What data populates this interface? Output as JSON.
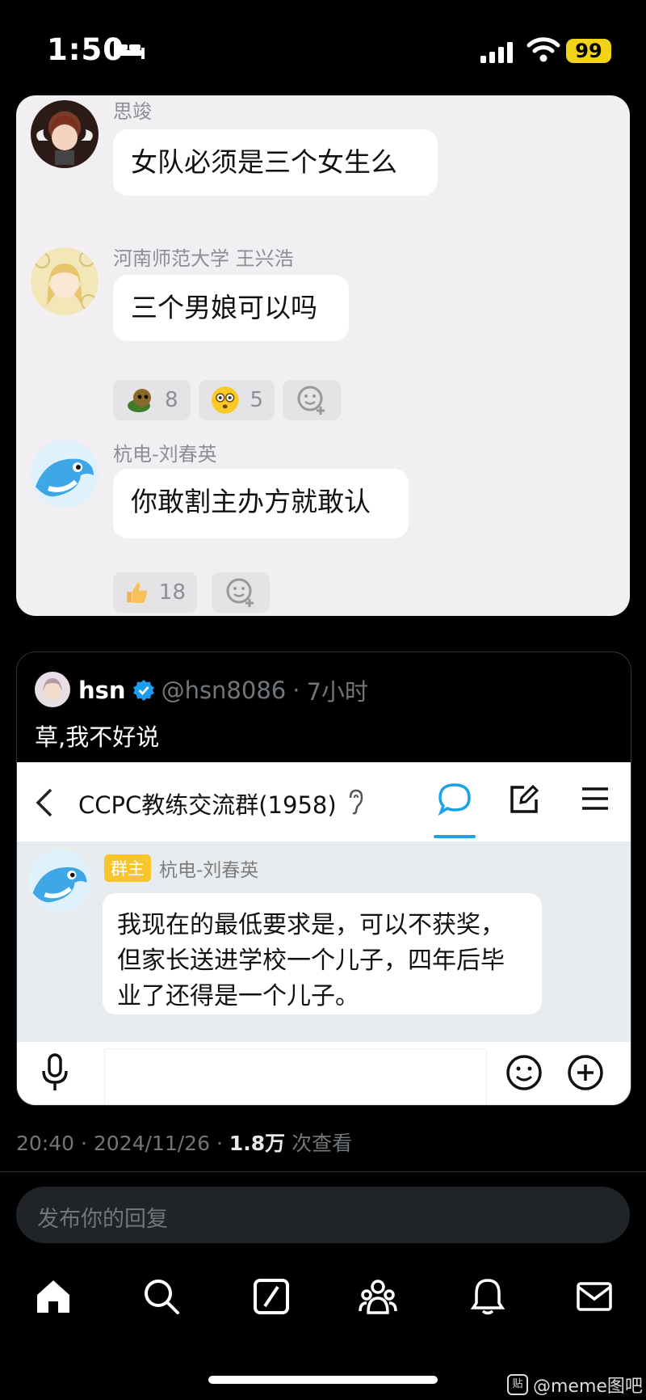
{
  "status_bar": {
    "time": "1:50",
    "battery": "99"
  },
  "chat": {
    "messages": [
      {
        "name": "思竣",
        "text": "女队必须是三个女生么"
      },
      {
        "name": "河南师范大学 王兴浩",
        "text": "三个男娘可以吗",
        "reactions": [
          {
            "icon": "turtle-emoji",
            "count": "8"
          },
          {
            "icon": "flushed-face-emoji",
            "count": "5"
          }
        ]
      },
      {
        "name": "杭电-刘春英",
        "text": "你敢割主办方就敢认",
        "reactions": [
          {
            "icon": "thumbs-up-emoji",
            "count": "18"
          }
        ]
      }
    ]
  },
  "tweet": {
    "display_name": "hsn",
    "handle": "@hsn8086",
    "time_ago": "7小时",
    "text": "草,我不好说",
    "embedded": {
      "group_title": "CCPC教练交流群(1958)",
      "badge": "群主",
      "sender": "杭电-刘春英",
      "message": "我现在的最低要求是，可以不获奖，但家长送进学校一个儿子，四年后毕业了还得是一个儿子。"
    }
  },
  "meta": {
    "time": "20:40",
    "date": "2024/11/26",
    "views": "1.8万",
    "views_label": "次查看"
  },
  "reply": {
    "placeholder": "发布你的回复"
  },
  "watermark": {
    "text": "@meme图吧",
    "icon_text": "贴"
  },
  "colors": {
    "accent": "#1d9bf0",
    "card_bg": "#f2eff2",
    "badge": "#f8c62a"
  }
}
